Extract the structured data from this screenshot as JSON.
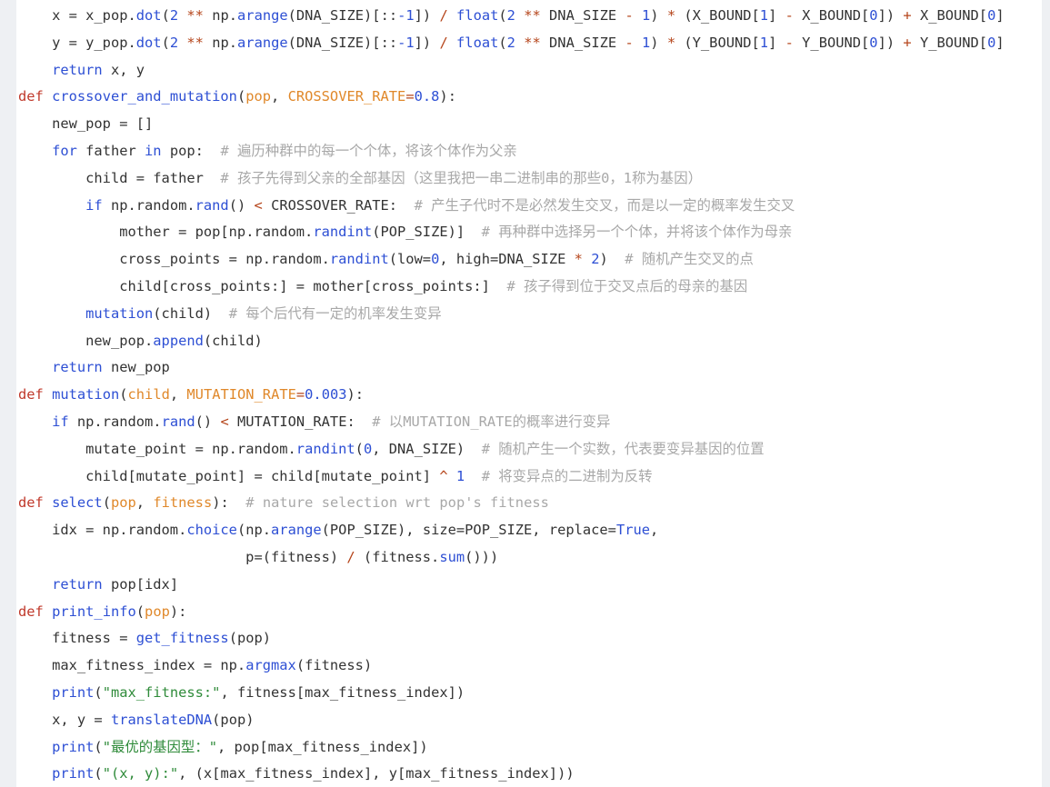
{
  "code_lines": [
    {
      "indent": 1,
      "tokens": [
        {
          "t": "x = x_pop.",
          "c": "txt"
        },
        {
          "t": "dot",
          "c": "fn"
        },
        {
          "t": "(",
          "c": "txt"
        },
        {
          "t": "2",
          "c": "num"
        },
        {
          "t": " ",
          "c": "txt"
        },
        {
          "t": "**",
          "c": "op"
        },
        {
          "t": " np.",
          "c": "txt"
        },
        {
          "t": "arange",
          "c": "fn"
        },
        {
          "t": "(DNA_SIZE)[::",
          "c": "txt"
        },
        {
          "t": "-1",
          "c": "num"
        },
        {
          "t": "]) ",
          "c": "txt"
        },
        {
          "t": "/",
          "c": "op"
        },
        {
          "t": " ",
          "c": "txt"
        },
        {
          "t": "float",
          "c": "bi"
        },
        {
          "t": "(",
          "c": "txt"
        },
        {
          "t": "2",
          "c": "num"
        },
        {
          "t": " ",
          "c": "txt"
        },
        {
          "t": "**",
          "c": "op"
        },
        {
          "t": " DNA_SIZE ",
          "c": "txt"
        },
        {
          "t": "-",
          "c": "op"
        },
        {
          "t": " ",
          "c": "txt"
        },
        {
          "t": "1",
          "c": "num"
        },
        {
          "t": ") ",
          "c": "txt"
        },
        {
          "t": "*",
          "c": "op"
        },
        {
          "t": " (X_BOUND[",
          "c": "txt"
        },
        {
          "t": "1",
          "c": "num"
        },
        {
          "t": "] ",
          "c": "txt"
        },
        {
          "t": "-",
          "c": "op"
        },
        {
          "t": " X_BOUND[",
          "c": "txt"
        },
        {
          "t": "0",
          "c": "num"
        },
        {
          "t": "]) ",
          "c": "txt"
        },
        {
          "t": "+",
          "c": "op"
        },
        {
          "t": " X_BOUND[",
          "c": "txt"
        },
        {
          "t": "0",
          "c": "num"
        },
        {
          "t": "]",
          "c": "txt"
        }
      ]
    },
    {
      "indent": 1,
      "tokens": [
        {
          "t": "y = y_pop.",
          "c": "txt"
        },
        {
          "t": "dot",
          "c": "fn"
        },
        {
          "t": "(",
          "c": "txt"
        },
        {
          "t": "2",
          "c": "num"
        },
        {
          "t": " ",
          "c": "txt"
        },
        {
          "t": "**",
          "c": "op"
        },
        {
          "t": " np.",
          "c": "txt"
        },
        {
          "t": "arange",
          "c": "fn"
        },
        {
          "t": "(DNA_SIZE)[::",
          "c": "txt"
        },
        {
          "t": "-1",
          "c": "num"
        },
        {
          "t": "]) ",
          "c": "txt"
        },
        {
          "t": "/",
          "c": "op"
        },
        {
          "t": " ",
          "c": "txt"
        },
        {
          "t": "float",
          "c": "bi"
        },
        {
          "t": "(",
          "c": "txt"
        },
        {
          "t": "2",
          "c": "num"
        },
        {
          "t": " ",
          "c": "txt"
        },
        {
          "t": "**",
          "c": "op"
        },
        {
          "t": " DNA_SIZE ",
          "c": "txt"
        },
        {
          "t": "-",
          "c": "op"
        },
        {
          "t": " ",
          "c": "txt"
        },
        {
          "t": "1",
          "c": "num"
        },
        {
          "t": ") ",
          "c": "txt"
        },
        {
          "t": "*",
          "c": "op"
        },
        {
          "t": " (Y_BOUND[",
          "c": "txt"
        },
        {
          "t": "1",
          "c": "num"
        },
        {
          "t": "] ",
          "c": "txt"
        },
        {
          "t": "-",
          "c": "op"
        },
        {
          "t": " Y_BOUND[",
          "c": "txt"
        },
        {
          "t": "0",
          "c": "num"
        },
        {
          "t": "]) ",
          "c": "txt"
        },
        {
          "t": "+",
          "c": "op"
        },
        {
          "t": " Y_BOUND[",
          "c": "txt"
        },
        {
          "t": "0",
          "c": "num"
        },
        {
          "t": "]",
          "c": "txt"
        }
      ]
    },
    {
      "indent": 1,
      "tokens": [
        {
          "t": "return",
          "c": "cf"
        },
        {
          "t": " x, y",
          "c": "txt"
        }
      ]
    },
    {
      "indent": 0,
      "tokens": [
        {
          "t": "def",
          "c": "kw"
        },
        {
          "t": " ",
          "c": "txt"
        },
        {
          "t": "crossover_and_mutation",
          "c": "fn"
        },
        {
          "t": "(",
          "c": "txt"
        },
        {
          "t": "pop",
          "c": "param"
        },
        {
          "t": ", ",
          "c": "txt"
        },
        {
          "t": "CROSSOVER_RATE",
          "c": "param"
        },
        {
          "t": "=",
          "c": "op"
        },
        {
          "t": "0.8",
          "c": "num"
        },
        {
          "t": "):",
          "c": "txt"
        }
      ]
    },
    {
      "indent": 1,
      "tokens": [
        {
          "t": "new_pop = []",
          "c": "txt"
        }
      ]
    },
    {
      "indent": 1,
      "tokens": [
        {
          "t": "for",
          "c": "cf"
        },
        {
          "t": " father ",
          "c": "txt"
        },
        {
          "t": "in",
          "c": "cf"
        },
        {
          "t": " pop:  ",
          "c": "txt"
        },
        {
          "t": "# 遍历种群中的每一个个体，将该个体作为父亲",
          "c": "cmt"
        }
      ]
    },
    {
      "indent": 2,
      "tokens": [
        {
          "t": "child = father  ",
          "c": "txt"
        },
        {
          "t": "# 孩子先得到父亲的全部基因（这里我把一串二进制串的那些0，1称为基因）",
          "c": "cmt"
        }
      ]
    },
    {
      "indent": 2,
      "tokens": [
        {
          "t": "if",
          "c": "cf"
        },
        {
          "t": " np.random.",
          "c": "txt"
        },
        {
          "t": "rand",
          "c": "fn"
        },
        {
          "t": "() ",
          "c": "txt"
        },
        {
          "t": "<",
          "c": "op"
        },
        {
          "t": " CROSSOVER_RATE:  ",
          "c": "txt"
        },
        {
          "t": "# 产生子代时不是必然发生交叉，而是以一定的概率发生交叉",
          "c": "cmt"
        }
      ]
    },
    {
      "indent": 3,
      "tokens": [
        {
          "t": "mother = pop[np.random.",
          "c": "txt"
        },
        {
          "t": "randint",
          "c": "fn"
        },
        {
          "t": "(POP_SIZE)]  ",
          "c": "txt"
        },
        {
          "t": "# 再种群中选择另一个个体，并将该个体作为母亲",
          "c": "cmt"
        }
      ]
    },
    {
      "indent": 3,
      "tokens": [
        {
          "t": "cross_points = np.random.",
          "c": "txt"
        },
        {
          "t": "randint",
          "c": "fn"
        },
        {
          "t": "(low=",
          "c": "txt"
        },
        {
          "t": "0",
          "c": "num"
        },
        {
          "t": ", high=DNA_SIZE ",
          "c": "txt"
        },
        {
          "t": "*",
          "c": "op"
        },
        {
          "t": " ",
          "c": "txt"
        },
        {
          "t": "2",
          "c": "num"
        },
        {
          "t": ")  ",
          "c": "txt"
        },
        {
          "t": "# 随机产生交叉的点",
          "c": "cmt"
        }
      ]
    },
    {
      "indent": 3,
      "tokens": [
        {
          "t": "child[cross_points:] = mother[cross_points:]  ",
          "c": "txt"
        },
        {
          "t": "# 孩子得到位于交叉点后的母亲的基因",
          "c": "cmt"
        }
      ]
    },
    {
      "indent": 2,
      "tokens": [
        {
          "t": "mutation",
          "c": "fn"
        },
        {
          "t": "(child)  ",
          "c": "txt"
        },
        {
          "t": "# 每个后代有一定的机率发生变异",
          "c": "cmt"
        }
      ]
    },
    {
      "indent": 2,
      "tokens": [
        {
          "t": "new_pop.",
          "c": "txt"
        },
        {
          "t": "append",
          "c": "fn"
        },
        {
          "t": "(child)",
          "c": "txt"
        }
      ]
    },
    {
      "indent": 1,
      "tokens": [
        {
          "t": "return",
          "c": "cf"
        },
        {
          "t": " new_pop",
          "c": "txt"
        }
      ]
    },
    {
      "indent": 0,
      "tokens": [
        {
          "t": "def",
          "c": "kw"
        },
        {
          "t": " ",
          "c": "txt"
        },
        {
          "t": "mutation",
          "c": "fn"
        },
        {
          "t": "(",
          "c": "txt"
        },
        {
          "t": "child",
          "c": "param"
        },
        {
          "t": ", ",
          "c": "txt"
        },
        {
          "t": "MUTATION_RATE",
          "c": "param"
        },
        {
          "t": "=",
          "c": "op"
        },
        {
          "t": "0.003",
          "c": "num"
        },
        {
          "t": "):",
          "c": "txt"
        }
      ]
    },
    {
      "indent": 1,
      "tokens": [
        {
          "t": "if",
          "c": "cf"
        },
        {
          "t": " np.random.",
          "c": "txt"
        },
        {
          "t": "rand",
          "c": "fn"
        },
        {
          "t": "() ",
          "c": "txt"
        },
        {
          "t": "<",
          "c": "op"
        },
        {
          "t": " MUTATION_RATE:  ",
          "c": "txt"
        },
        {
          "t": "# 以MUTATION_RATE的概率进行变异",
          "c": "cmt"
        }
      ]
    },
    {
      "indent": 2,
      "tokens": [
        {
          "t": "mutate_point = np.random.",
          "c": "txt"
        },
        {
          "t": "randint",
          "c": "fn"
        },
        {
          "t": "(",
          "c": "txt"
        },
        {
          "t": "0",
          "c": "num"
        },
        {
          "t": ", DNA_SIZE)  ",
          "c": "txt"
        },
        {
          "t": "# 随机产生一个实数，代表要变异基因的位置",
          "c": "cmt"
        }
      ]
    },
    {
      "indent": 2,
      "tokens": [
        {
          "t": "child[mutate_point] = child[mutate_point] ",
          "c": "txt"
        },
        {
          "t": "^",
          "c": "op"
        },
        {
          "t": " ",
          "c": "txt"
        },
        {
          "t": "1",
          "c": "num"
        },
        {
          "t": "  ",
          "c": "txt"
        },
        {
          "t": "# 将变异点的二进制为反转",
          "c": "cmt"
        }
      ]
    },
    {
      "indent": 0,
      "tokens": [
        {
          "t": "def",
          "c": "kw"
        },
        {
          "t": " ",
          "c": "txt"
        },
        {
          "t": "select",
          "c": "fn"
        },
        {
          "t": "(",
          "c": "txt"
        },
        {
          "t": "pop",
          "c": "param"
        },
        {
          "t": ", ",
          "c": "txt"
        },
        {
          "t": "fitness",
          "c": "param"
        },
        {
          "t": "):  ",
          "c": "txt"
        },
        {
          "t": "# nature selection wrt pop's fitness",
          "c": "cmt"
        }
      ]
    },
    {
      "indent": 1,
      "tokens": [
        {
          "t": "idx = np.random.",
          "c": "txt"
        },
        {
          "t": "choice",
          "c": "fn"
        },
        {
          "t": "(np.",
          "c": "txt"
        },
        {
          "t": "arange",
          "c": "fn"
        },
        {
          "t": "(POP_SIZE), size=POP_SIZE, replace=",
          "c": "txt"
        },
        {
          "t": "True",
          "c": "num"
        },
        {
          "t": ",",
          "c": "txt"
        }
      ]
    },
    {
      "indent": 0,
      "tokens": [
        {
          "t": "                           p=(fitness) ",
          "c": "txt"
        },
        {
          "t": "/",
          "c": "op"
        },
        {
          "t": " (fitness.",
          "c": "txt"
        },
        {
          "t": "sum",
          "c": "fn"
        },
        {
          "t": "()))",
          "c": "txt"
        }
      ]
    },
    {
      "indent": 1,
      "tokens": [
        {
          "t": "return",
          "c": "cf"
        },
        {
          "t": " pop[idx]",
          "c": "txt"
        }
      ]
    },
    {
      "indent": 0,
      "tokens": [
        {
          "t": "def",
          "c": "kw"
        },
        {
          "t": " ",
          "c": "txt"
        },
        {
          "t": "print_info",
          "c": "fn"
        },
        {
          "t": "(",
          "c": "txt"
        },
        {
          "t": "pop",
          "c": "param"
        },
        {
          "t": "):",
          "c": "txt"
        }
      ]
    },
    {
      "indent": 1,
      "tokens": [
        {
          "t": "fitness = ",
          "c": "txt"
        },
        {
          "t": "get_fitness",
          "c": "fn"
        },
        {
          "t": "(pop)",
          "c": "txt"
        }
      ]
    },
    {
      "indent": 1,
      "tokens": [
        {
          "t": "max_fitness_index = np.",
          "c": "txt"
        },
        {
          "t": "argmax",
          "c": "fn"
        },
        {
          "t": "(fitness)",
          "c": "txt"
        }
      ]
    },
    {
      "indent": 1,
      "tokens": [
        {
          "t": "print",
          "c": "bi"
        },
        {
          "t": "(",
          "c": "txt"
        },
        {
          "t": "\"max_fitness:\"",
          "c": "str"
        },
        {
          "t": ", fitness[max_fitness_index])",
          "c": "txt"
        }
      ]
    },
    {
      "indent": 1,
      "tokens": [
        {
          "t": "x, y = ",
          "c": "txt"
        },
        {
          "t": "translateDNA",
          "c": "fn"
        },
        {
          "t": "(pop)",
          "c": "txt"
        }
      ]
    },
    {
      "indent": 1,
      "tokens": [
        {
          "t": "print",
          "c": "bi"
        },
        {
          "t": "(",
          "c": "txt"
        },
        {
          "t": "\"最优的基因型：\"",
          "c": "str"
        },
        {
          "t": ", pop[max_fitness_index])",
          "c": "txt"
        }
      ]
    },
    {
      "indent": 1,
      "tokens": [
        {
          "t": "print",
          "c": "bi"
        },
        {
          "t": "(",
          "c": "txt"
        },
        {
          "t": "\"(x, y):\"",
          "c": "str"
        },
        {
          "t": ", (x[max_fitness_index], y[max_fitness_index]))",
          "c": "txt"
        }
      ]
    }
  ]
}
